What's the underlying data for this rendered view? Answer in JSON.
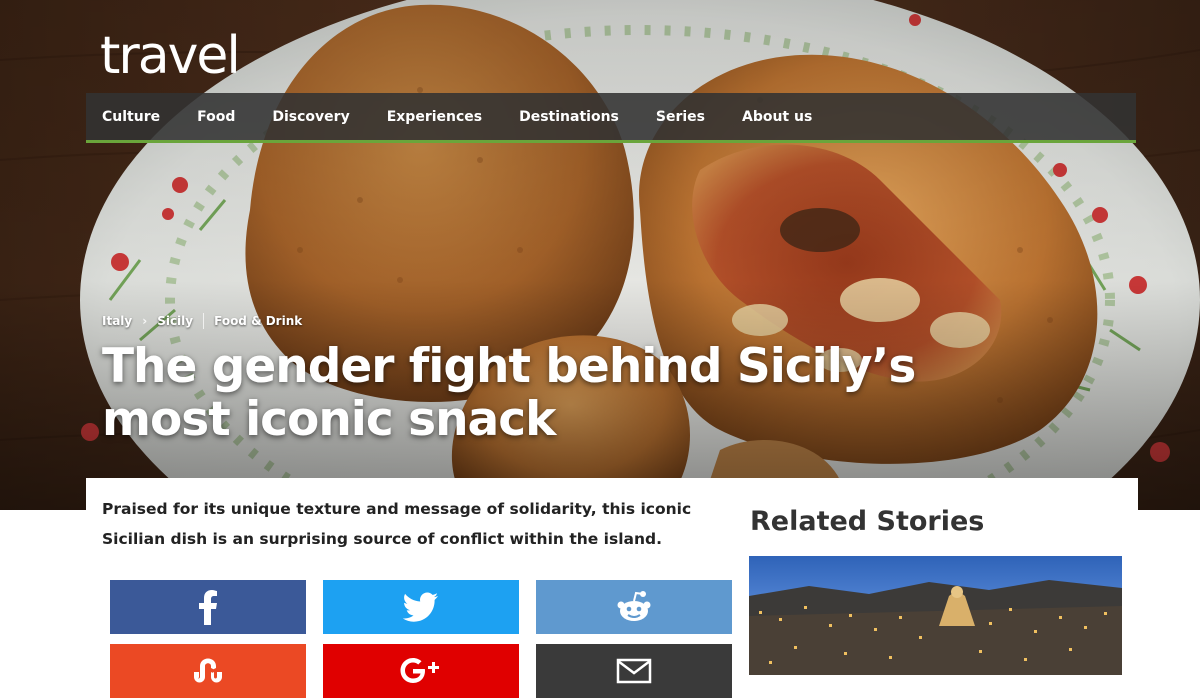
{
  "brand": {
    "logo_text": "travel"
  },
  "nav": {
    "items": [
      {
        "label": "Culture"
      },
      {
        "label": "Food"
      },
      {
        "label": "Discovery"
      },
      {
        "label": "Experiences"
      },
      {
        "label": "Destinations"
      },
      {
        "label": "Series"
      },
      {
        "label": "About us"
      }
    ],
    "accent_color": "#6aa53b"
  },
  "article": {
    "breadcrumb": [
      {
        "label": "Italy"
      },
      {
        "label": "Sicily"
      },
      {
        "label": "Food & Drink"
      }
    ],
    "headline": "The gender fight behind Sicily’s most iconic snack",
    "standfirst": "Praised for its unique texture and message of solidarity, this iconic Sicilian dish is an surprising source of conflict within the island."
  },
  "share": {
    "buttons": [
      {
        "network": "facebook",
        "icon": "facebook-icon",
        "color": "#3b5998"
      },
      {
        "network": "twitter",
        "icon": "twitter-icon",
        "color": "#1da1f2"
      },
      {
        "network": "reddit",
        "icon": "reddit-icon",
        "color": "#5f99cf"
      },
      {
        "network": "stumbleupon",
        "icon": "stumbleupon-icon",
        "color": "#eb4924"
      },
      {
        "network": "google-plus",
        "icon": "google-plus-icon",
        "color": "#e00000"
      },
      {
        "network": "email",
        "icon": "email-icon",
        "color": "#3a3a3a"
      }
    ]
  },
  "related": {
    "title": "Related Stories"
  }
}
